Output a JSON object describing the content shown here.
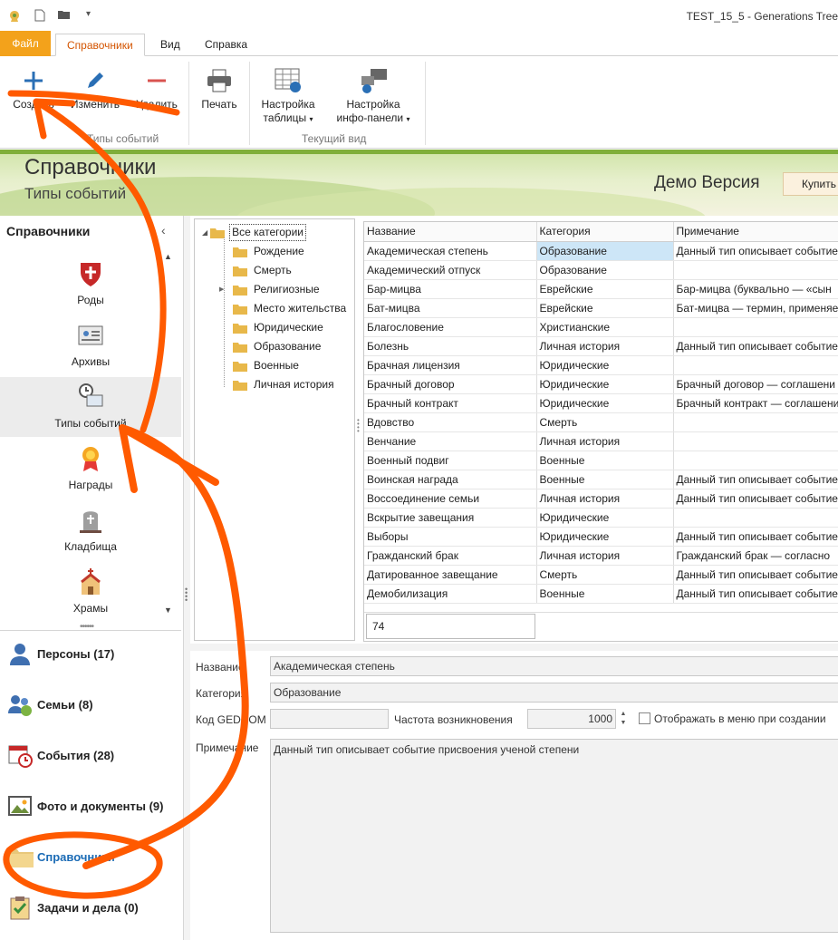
{
  "window": {
    "title": "TEST_15_5 - Generations Tree"
  },
  "tabs": {
    "file": "Файл",
    "active": "Справочники",
    "view": "Вид",
    "help": "Справка"
  },
  "ribbon": {
    "create": "Создать",
    "edit": "Изменить",
    "delete": "Удалить",
    "print": "Печать",
    "table_l1": "Настройка",
    "table_l2": "таблицы",
    "panel_l1": "Настройка",
    "panel_l2": "инфо-панели",
    "group1": "Типы событий",
    "group2": "Текущий вид"
  },
  "banner": {
    "title": "Справочники",
    "subtitle": "Типы событий",
    "demo": "Демо Версия",
    "buy": "Купить"
  },
  "leftnav": {
    "header": "Справочники",
    "items": [
      {
        "label": "Роды",
        "icon": "clan-shield-icon"
      },
      {
        "label": "Архивы",
        "icon": "archive-icon"
      },
      {
        "label": "Типы событий",
        "icon": "event-types-icon"
      },
      {
        "label": "Награды",
        "icon": "award-icon"
      },
      {
        "label": "Кладбища",
        "icon": "cemetery-icon"
      },
      {
        "label": "Храмы",
        "icon": "church-icon"
      }
    ],
    "sections": [
      {
        "label": "Персоны (17)",
        "icon": "person-icon"
      },
      {
        "label": "Семьи (8)",
        "icon": "family-icon"
      },
      {
        "label": "События (28)",
        "icon": "calendar-icon"
      },
      {
        "label": "Фото и документы (9)",
        "icon": "photo-icon"
      },
      {
        "label": "Справочники",
        "icon": "folder-icon"
      },
      {
        "label": "Задачи и дела (0)",
        "icon": "clipboard-icon"
      }
    ]
  },
  "tree": {
    "root": "Все категории",
    "children": [
      "Рождение",
      "Смерть",
      "Религиозные",
      "Место жительства",
      "Юридические",
      "Образование",
      "Военные",
      "Личная история"
    ]
  },
  "grid": {
    "columns": [
      "Название",
      "Категория",
      "Примечание"
    ],
    "rows": [
      [
        "Академическая степень",
        "Образование",
        "Данный тип описывает событие"
      ],
      [
        "Академический отпуск",
        "Образование",
        ""
      ],
      [
        "Бар-мицва",
        "Еврейские",
        "Бар-мицва (буквально — «сын"
      ],
      [
        "Бат-мицва",
        "Еврейские",
        "Бат-мицва — термин, применяе"
      ],
      [
        "Благословение",
        "Христианские",
        ""
      ],
      [
        "Болезнь",
        "Личная история",
        "Данный тип описывает событие"
      ],
      [
        "Брачная лицензия",
        "Юридические",
        ""
      ],
      [
        "Брачный договор",
        "Юридические",
        "Брачный договор — соглашени"
      ],
      [
        "Брачный контракт",
        "Юридические",
        "Брачный контракт — соглашени"
      ],
      [
        "Вдовство",
        "Смерть",
        ""
      ],
      [
        "Венчание",
        "Личная история",
        ""
      ],
      [
        "Военный подвиг",
        "Военные",
        ""
      ],
      [
        "Воинская награда",
        "Военные",
        "Данный тип описывает событие"
      ],
      [
        "Воссоединение семьи",
        "Личная история",
        "Данный тип описывает событие"
      ],
      [
        "Вскрытие завещания",
        "Юридические",
        ""
      ],
      [
        "Выборы",
        "Юридические",
        "Данный тип описывает событие"
      ],
      [
        "Гражданский брак",
        "Личная история",
        "Гражданский брак — согласно"
      ],
      [
        "Датированное завещание",
        "Смерть",
        "Данный тип описывает событие"
      ],
      [
        "Демобилизация",
        "Военные",
        "Данный тип описывает событие"
      ]
    ],
    "count": "74"
  },
  "details": {
    "name_label": "Название",
    "name_value": "Академическая степень",
    "category_label": "Категория",
    "category_value": "Образование",
    "gedcom_label": "Код GEDCOM",
    "gedcom_value": "",
    "freq_label": "Частота возникновения",
    "freq_value": "1000",
    "show_in_menu_label": "Отображать в меню при создании",
    "note_label": "Примечание",
    "note_value": "Данный тип описывает событие присвоения ученой степени"
  },
  "colors": {
    "accent_orange": "#f3a21b",
    "annotation": "#ff5a00",
    "selection": "#cde6f7",
    "active_link": "#1b6bb5"
  }
}
